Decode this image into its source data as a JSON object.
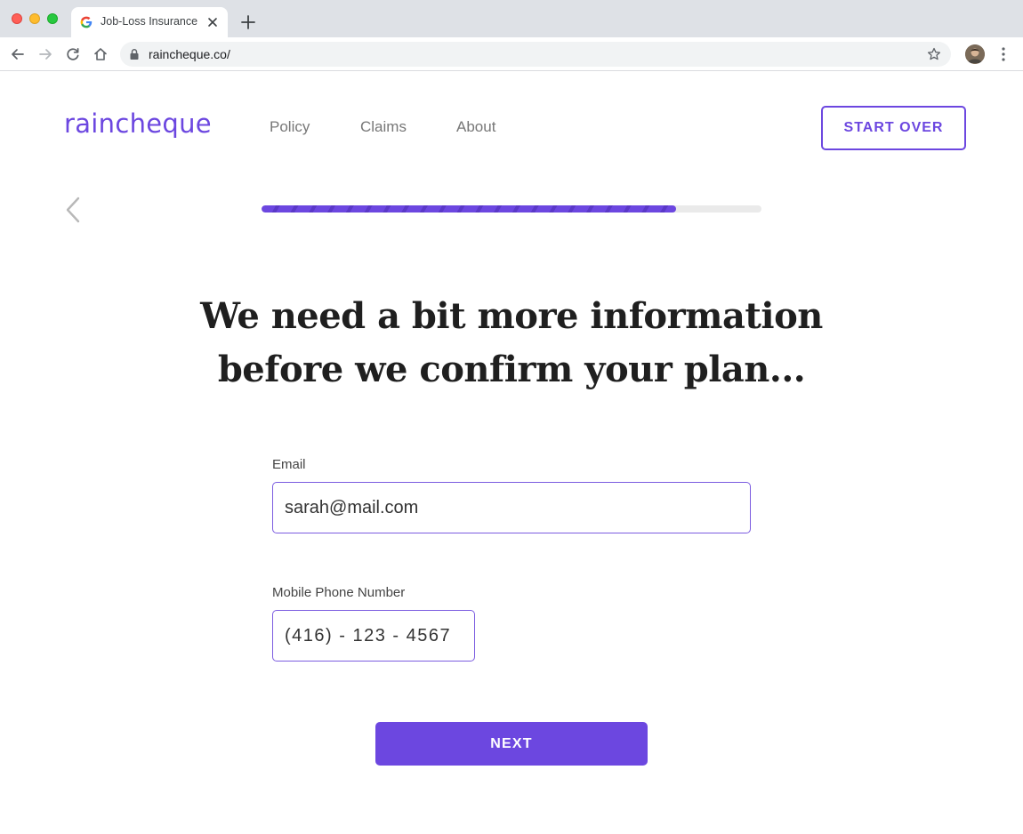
{
  "browser": {
    "tab_title": "Job-Loss Insurance",
    "url": "raincheque.co/"
  },
  "site": {
    "logo": "raincheque",
    "nav": [
      {
        "label": "Policy"
      },
      {
        "label": "Claims"
      },
      {
        "label": "About"
      }
    ],
    "start_over_label": "START OVER"
  },
  "progress": {
    "fraction": 0.83
  },
  "form": {
    "headline_line1": "We need a bit more information",
    "headline_line2": "before we confirm your plan...",
    "email_label": "Email",
    "email_value": "sarah@mail.com",
    "phone_label": "Mobile Phone Number",
    "phone_value": "(416) - 123 - 4567",
    "next_label": "NEXT"
  },
  "colors": {
    "accent": "#6c47e0",
    "chrome_bg": "#dee1e6",
    "text_dark": "#1f1f1f"
  },
  "icons": {
    "favicon": "google-g-icon",
    "close": "close-icon",
    "new_tab": "plus-icon",
    "back": "arrow-left-icon",
    "forward": "arrow-right-icon",
    "reload": "reload-icon",
    "home": "home-icon",
    "lock": "lock-icon",
    "bookmark": "star-icon",
    "menu": "kebab-menu-icon",
    "form_back": "chevron-left-icon"
  }
}
